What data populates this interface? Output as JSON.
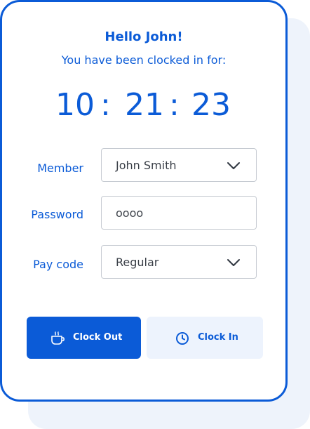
{
  "header": {
    "greeting": "Hello John!",
    "subtitle": "You have been clocked in for:"
  },
  "timer": {
    "hours": "10",
    "minutes": "21",
    "seconds": "23",
    "separator": ":"
  },
  "form": {
    "member": {
      "label": "Member",
      "value": "John Smith"
    },
    "password": {
      "label": "Password",
      "value": "oooo"
    },
    "pay_code": {
      "label": "Pay code",
      "value": "Regular"
    }
  },
  "actions": {
    "clock_out_label": "Clock Out",
    "clock_in_label": "Clock In"
  },
  "icons": {
    "clock_out": "coffee-cup-icon",
    "clock_in": "clock-icon",
    "dropdown": "chevron-down-icon"
  },
  "colors": {
    "primary": "#0b5bd7",
    "secondary_button_bg": "#edf3fd",
    "backdrop": "#eef3fb"
  }
}
